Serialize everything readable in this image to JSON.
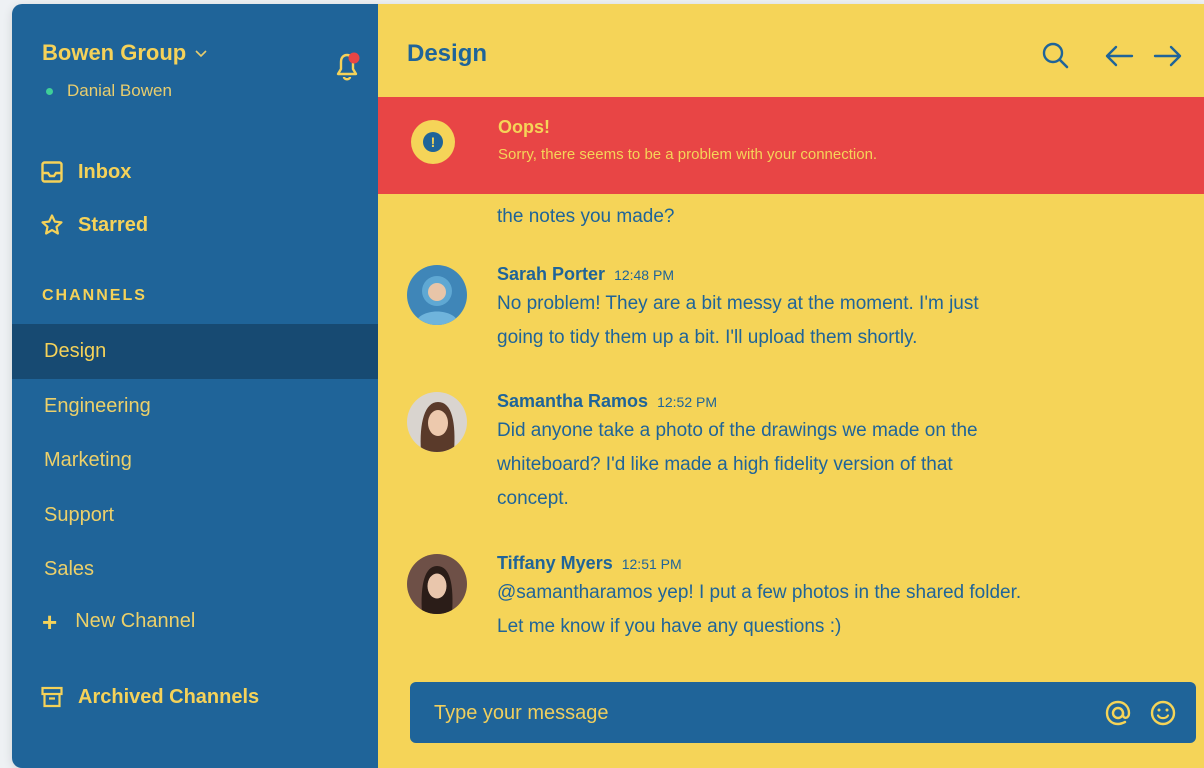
{
  "sidebar": {
    "group_name": "Bowen Group",
    "user_name": "Danial Bowen",
    "status_color": "#3fcf98",
    "nav": [
      {
        "label": "Inbox",
        "icon": "inbox-icon"
      },
      {
        "label": "Starred",
        "icon": "star-icon"
      }
    ],
    "channels_title": "CHANNELS",
    "channels": [
      "Design",
      "Engineering",
      "Marketing",
      "Support",
      "Sales"
    ],
    "active_channel": "Design",
    "new_channel_label": "New Channel",
    "archived_label": "Archived Channels"
  },
  "main": {
    "title": "Design",
    "header_icons": [
      "search-icon",
      "arrow-left-icon",
      "arrow-right-icon"
    ],
    "alert": {
      "title": "Oops!",
      "text": "Sorry, there seems to be a problem with your connection."
    },
    "fragment": "the notes you made?",
    "messages": [
      {
        "author": "Sarah Porter",
        "time": "12:48 PM",
        "lines": [
          "No problem! They are a bit messy at the moment. I'm just",
          "going to tidy them up a bit. I'll upload them shortly."
        ]
      },
      {
        "author": "Samantha Ramos",
        "time": "12:52 PM",
        "lines": [
          "Did anyone take a photo of the drawings we made on the",
          "whiteboard? I'd like made a high fidelity version of that",
          "concept."
        ]
      },
      {
        "author": "Tiffany Myers",
        "time": "12:51 PM",
        "lines": [
          "@samantharamos yep! I put a few photos in the shared folder.",
          "Let me know if you have any questions :)"
        ]
      }
    ],
    "composer": {
      "placeholder": "Type your message",
      "icons": [
        "at-icon",
        "emoji-icon"
      ]
    }
  },
  "colors": {
    "sidebar": "#1f6499",
    "active_channel": "#174a72",
    "accent_yellow": "#f5d458",
    "alert_red": "#e84545"
  }
}
